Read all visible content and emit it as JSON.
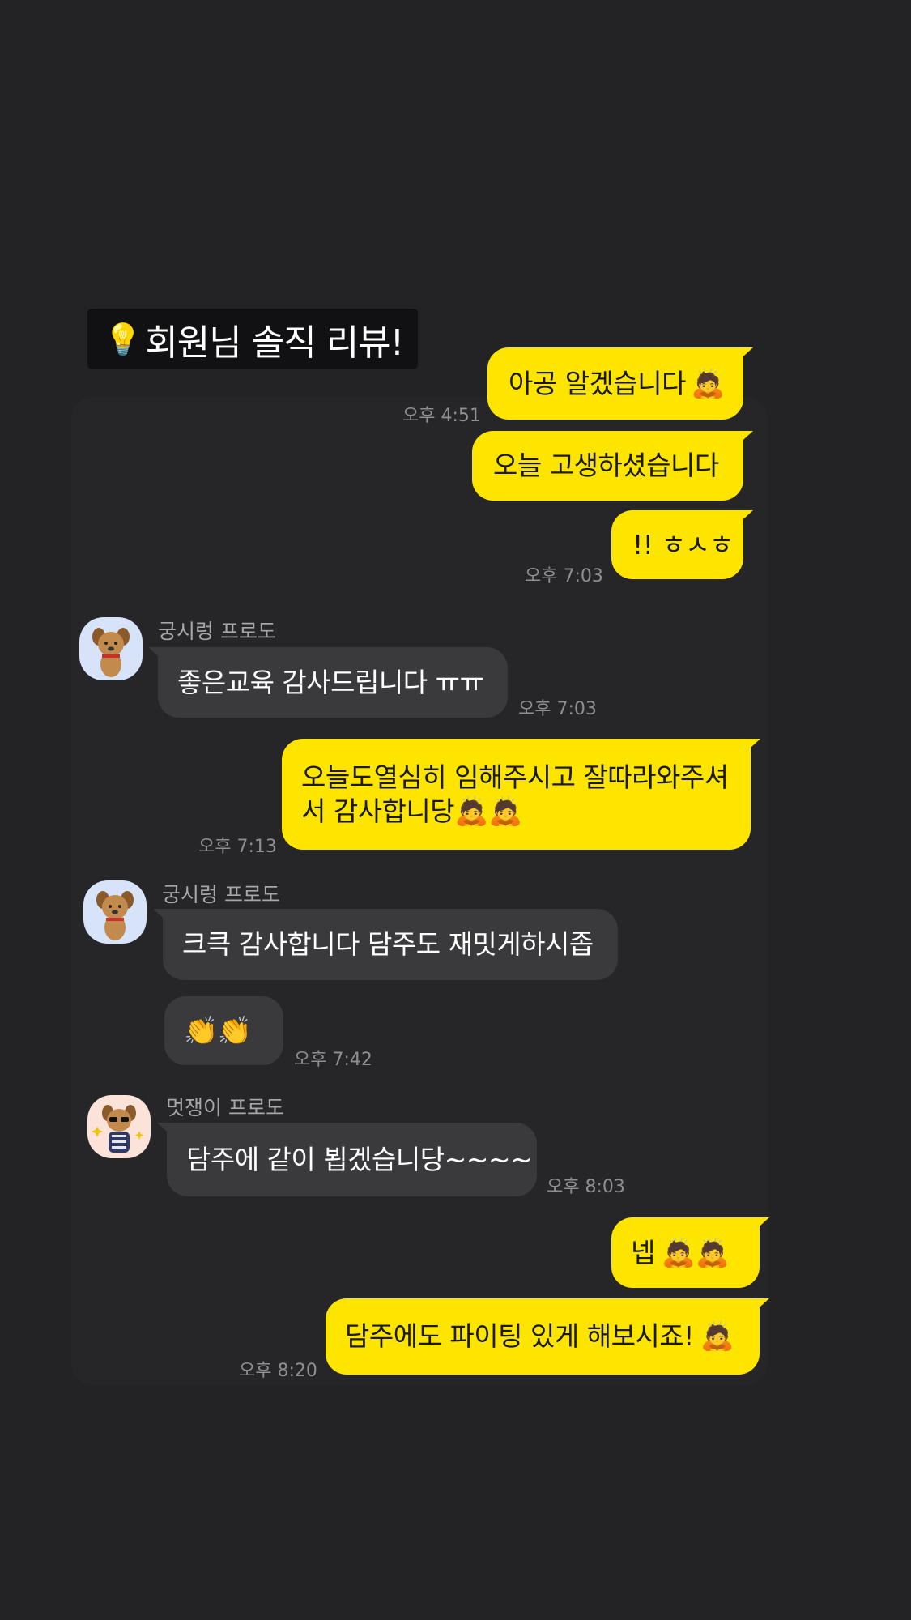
{
  "banner": {
    "icon": "lightbulb-icon",
    "bulb_glyph": "💡",
    "title": "회원님 솔직 리뷰!"
  },
  "colors": {
    "background": "#232326",
    "my_bubble": "#FEE500",
    "their_bubble": "#3A3A3D",
    "timestamp": "#8E8E93"
  },
  "messages": [
    {
      "side": "mine",
      "text": "아공 알겠습니다",
      "emoji": "🙇",
      "time": "오후 4:51"
    },
    {
      "side": "mine",
      "text": "오늘 고생하셨습니다",
      "time": ""
    },
    {
      "side": "mine",
      "text": "!! ㅎㅅㅎ",
      "time": "오후 7:03"
    },
    {
      "side": "theirs",
      "sender": "궁시렁 프로도",
      "avatar": "frodo-dog-avatar",
      "text": "좋은교육 감사드립니다 ㅠㅠ",
      "time": "오후 7:03"
    },
    {
      "side": "mine",
      "text": "오늘도열심히 임해주시고 잘따라와주셔서 감사합니당",
      "emoji": "🙇🙇",
      "time": "오후 7:13"
    },
    {
      "side": "theirs",
      "sender": "궁시렁 프로도",
      "avatar": "frodo-dog-avatar",
      "text": "크큭 감사합니다 담주도 재밋게하시좁",
      "time": ""
    },
    {
      "side": "theirs",
      "emoji": "👏👏",
      "time": "오후 7:42"
    },
    {
      "side": "theirs",
      "sender": "멋쟁이 프로도",
      "avatar": "frodo-sunglasses-avatar",
      "text": "담주에 같이 뵙겠습니당~~~~",
      "time": "오후 8:03"
    },
    {
      "side": "mine",
      "text": "넵",
      "emoji": "🙇🙇",
      "time": ""
    },
    {
      "side": "mine",
      "text": "담주에도 파이팅 있게 해보시죠!",
      "emoji": "🙇",
      "time": "오후 8:20"
    }
  ]
}
